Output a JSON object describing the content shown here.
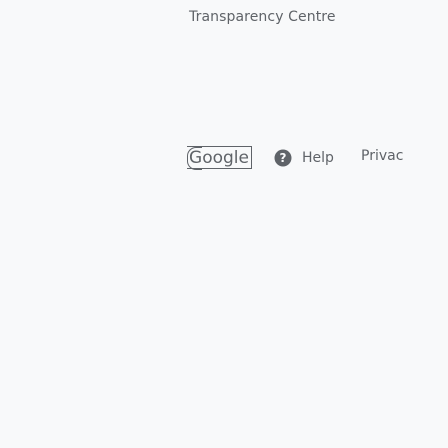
{
  "header": {
    "title": "Transparency Centre"
  },
  "footer": {
    "logo_text_cap": "G",
    "logo_text_rest": "oogle",
    "help_label": "Help",
    "privacy_label": "Privac"
  },
  "icons": {
    "help": "help-circle-icon"
  },
  "colors": {
    "background": "#f8f9fa",
    "text": "#5f6368"
  }
}
